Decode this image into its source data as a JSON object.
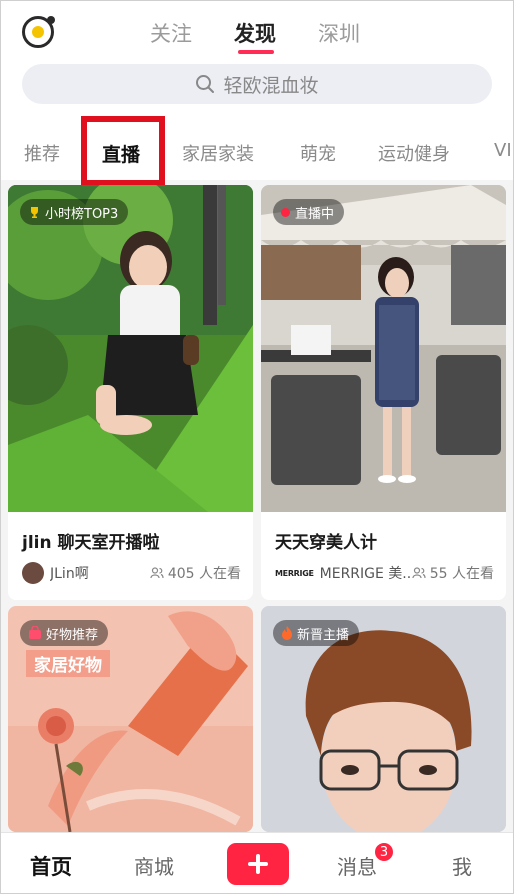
{
  "header": {
    "tabs": [
      {
        "label": "关注",
        "active": false
      },
      {
        "label": "发现",
        "active": true
      },
      {
        "label": "深圳",
        "active": false
      }
    ],
    "search_placeholder": "轻欧混血妆",
    "categories": [
      {
        "label": "推荐",
        "active": false
      },
      {
        "label": "直播",
        "active": true
      },
      {
        "label": "家居家装",
        "active": false
      },
      {
        "label": "萌宠",
        "active": false
      },
      {
        "label": "运动健身",
        "active": false
      },
      {
        "label": "VI",
        "active": false
      }
    ]
  },
  "feed": [
    {
      "badge": "小时榜TOP3",
      "badge_icon": "trophy-icon",
      "title": "jlin 聊天室开播啦",
      "author": "JLin啊",
      "viewers": "405 人在看"
    },
    {
      "badge": "直播中",
      "badge_icon": "live-dot-icon",
      "title": "天天穿美人计",
      "author_logo": "MERRIGE",
      "author": "MERRIGE 美...",
      "viewers": "55 人在看"
    },
    {
      "badge": "好物推荐",
      "badge_icon": "shopping-bag-icon",
      "overlay_text": "家居好物"
    },
    {
      "badge": "新晋主播",
      "badge_icon": "fire-icon"
    }
  ],
  "bottom_nav": {
    "items": [
      {
        "label": "首页",
        "active": true
      },
      {
        "label": "商城",
        "active": false
      },
      {
        "label": "消息",
        "active": false
      },
      {
        "label": "我",
        "active": false
      }
    ],
    "messages_badge": "3"
  },
  "colors": {
    "accent": "#ff2442",
    "highlight": "#e0101f"
  }
}
